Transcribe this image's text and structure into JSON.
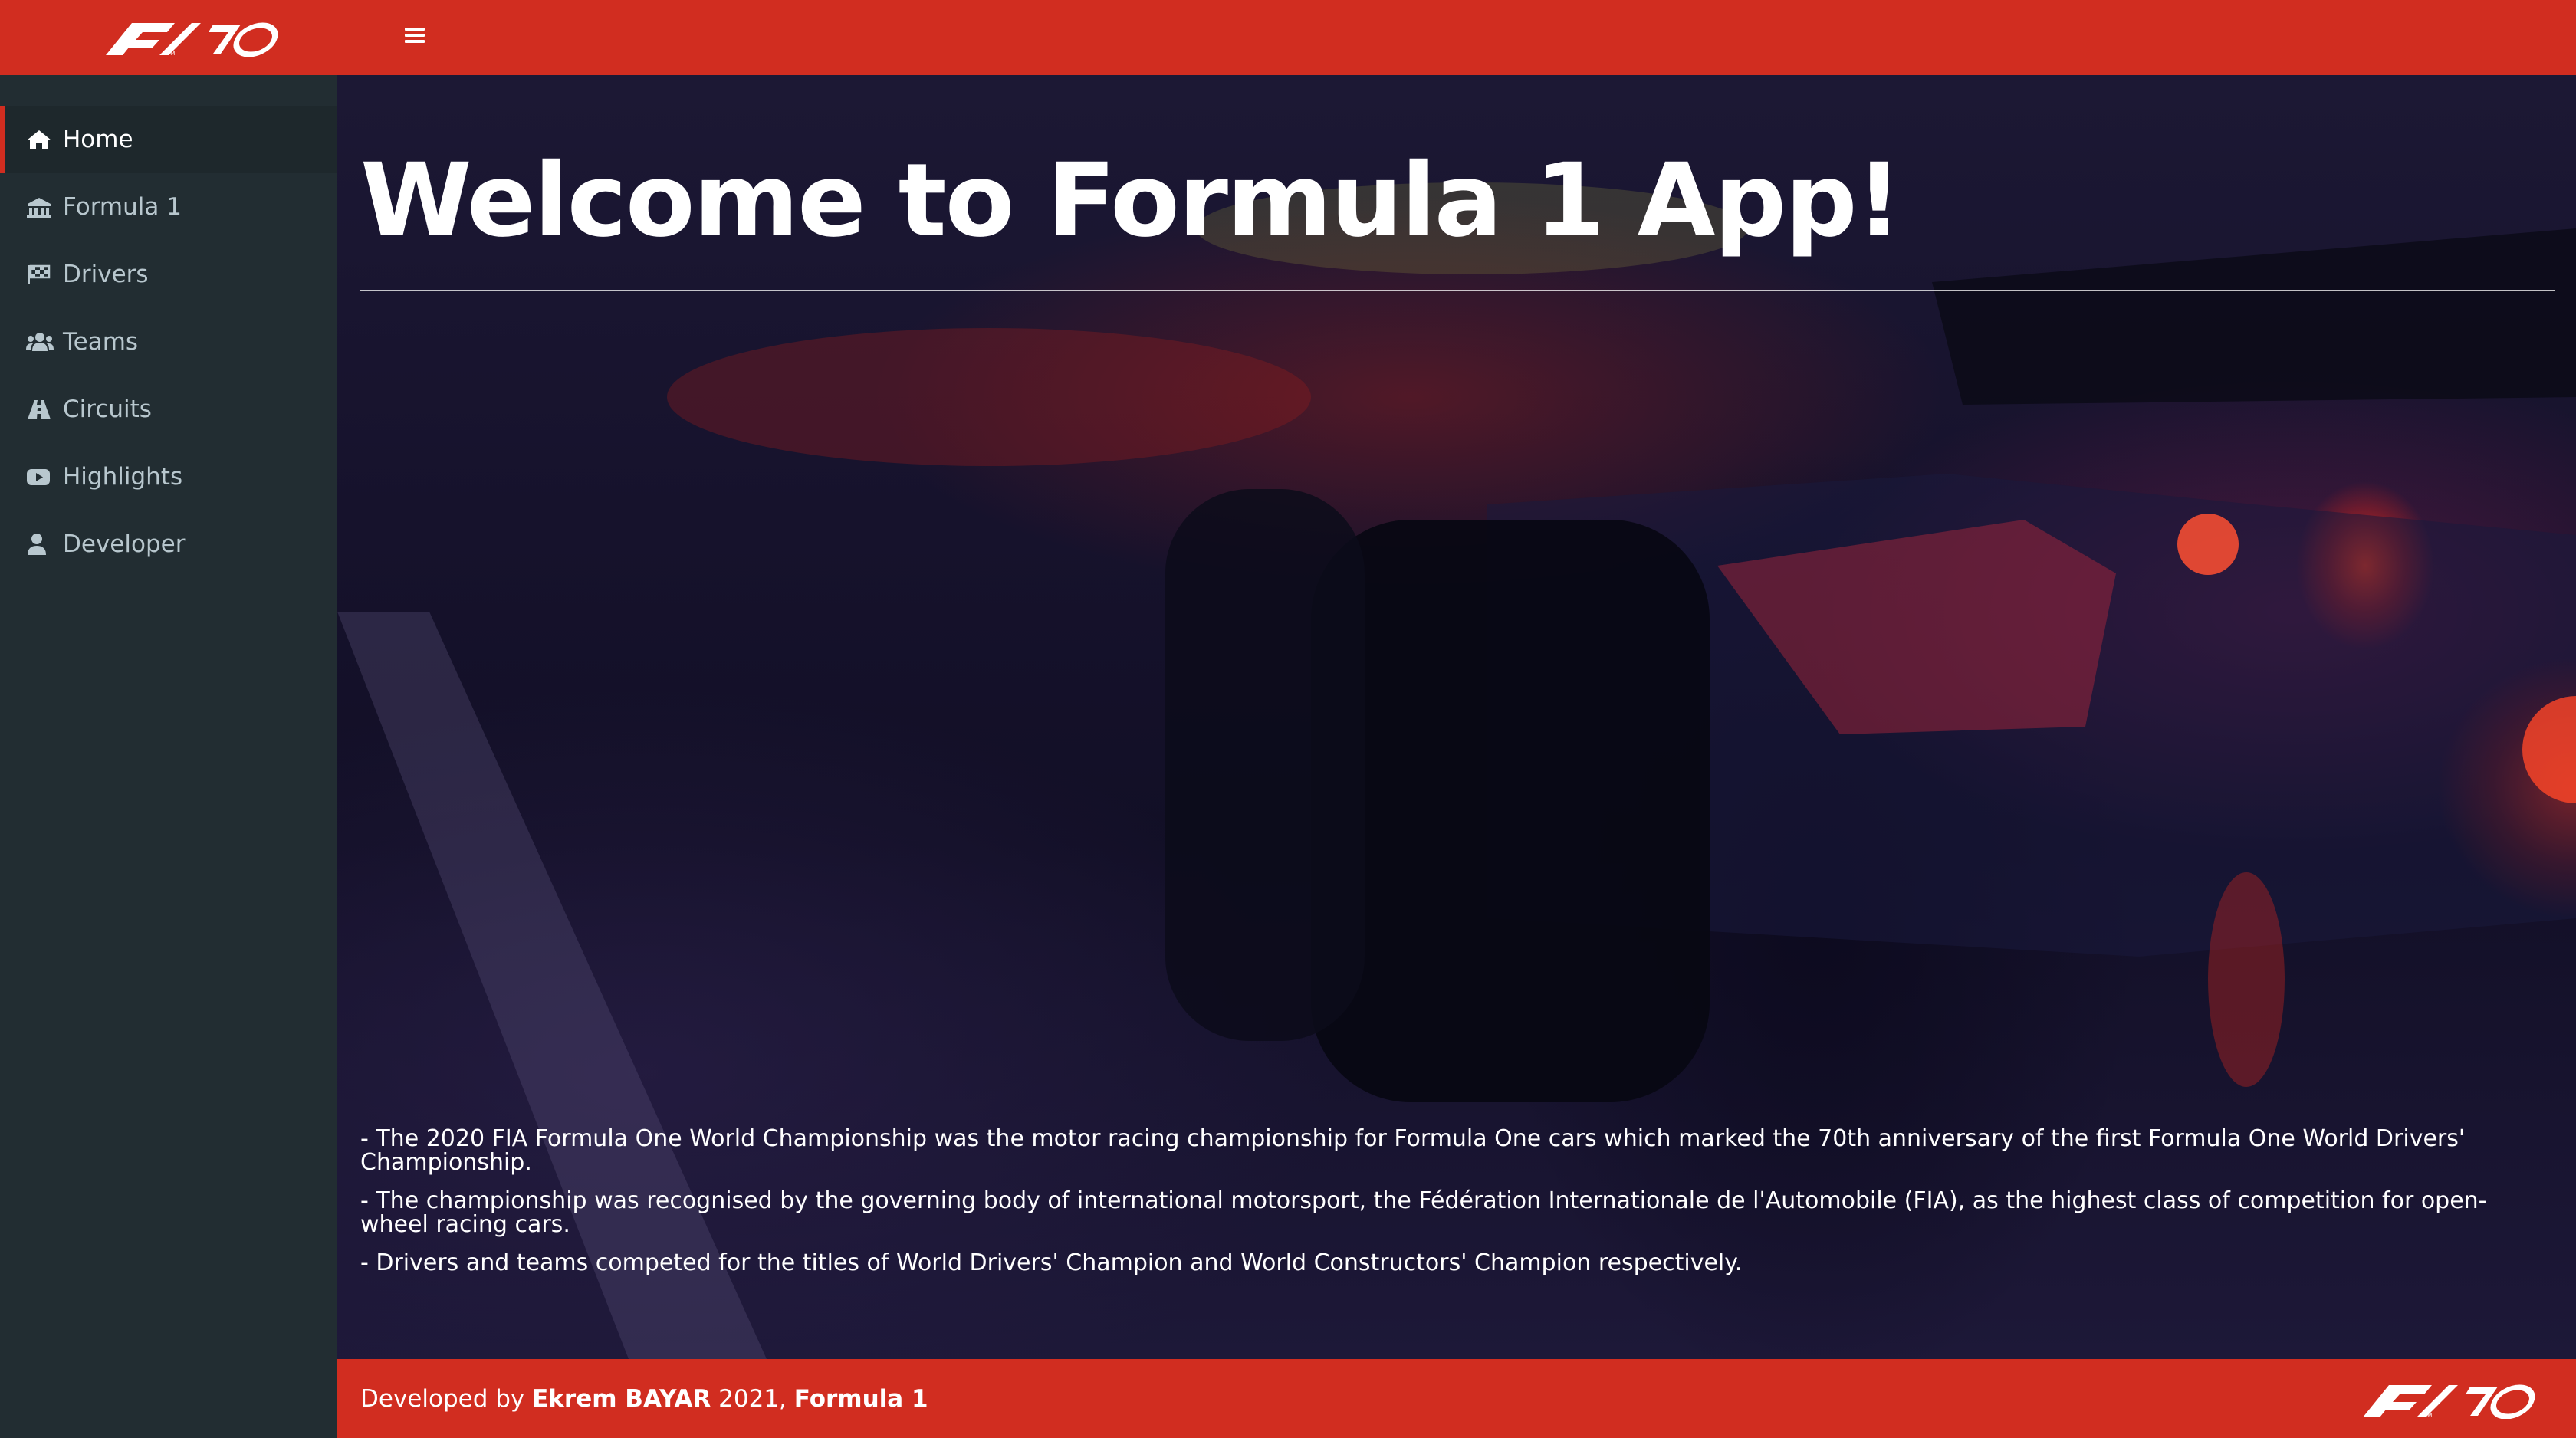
{
  "header": {
    "logo_alt": "F1 70",
    "menu_icon": "hamburger-icon"
  },
  "sidebar": {
    "items": [
      {
        "label": "Home",
        "icon": "home-icon",
        "active": true
      },
      {
        "label": "Formula 1",
        "icon": "building-icon",
        "active": false
      },
      {
        "label": "Drivers",
        "icon": "flag-checkered-icon",
        "active": false
      },
      {
        "label": "Teams",
        "icon": "users-icon",
        "active": false
      },
      {
        "label": "Circuits",
        "icon": "road-icon",
        "active": false
      },
      {
        "label": "Highlights",
        "icon": "youtube-icon",
        "active": false
      },
      {
        "label": "Developer",
        "icon": "user-icon",
        "active": false
      }
    ]
  },
  "main": {
    "title": "Welcome to Formula 1 App!",
    "facts": [
      "- The 2020 FIA Formula One World Championship was the motor racing championship for Formula One cars which marked the 70th anniversary of the first Formula One World Drivers' Championship.",
      "- The championship was recognised by the governing body of international motorsport, the Fédération Internationale de l'Automobile (FIA), as the highest class of competition for open-wheel racing cars.",
      "- Drivers and teams competed for the titles of World Drivers' Champion and World Constructors' Champion respectively."
    ]
  },
  "footer": {
    "prefix": "Developed by ",
    "author": "Ekrem BAYAR",
    "year": " 2021, ",
    "brand": "Formula 1"
  },
  "colors": {
    "accent": "#d12d20",
    "sidebar_bg": "#222d32",
    "sidebar_active_bg": "#1e282c",
    "sidebar_text": "#b8c7ce"
  }
}
